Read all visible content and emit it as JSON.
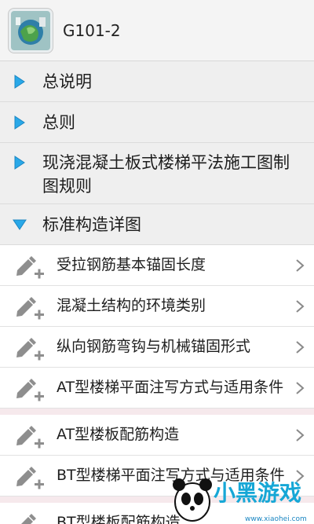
{
  "app": {
    "title": "G101-2",
    "icon": "book-cover-icon"
  },
  "sections": [
    {
      "label": "总说明",
      "state": "collapsed"
    },
    {
      "label": "总则",
      "state": "collapsed"
    },
    {
      "label": "现浇混凝土板式楼梯平法施工图制图规则",
      "state": "collapsed"
    },
    {
      "label": "标准构造详图",
      "state": "expanded"
    }
  ],
  "items": [
    {
      "label": "受拉钢筋基本锚固长度"
    },
    {
      "label": "混凝土结构的环境类别"
    },
    {
      "label": "纵向钢筋弯钩与机械锚固形式"
    },
    {
      "label": "AT型楼梯平面注写方式与适用条件"
    },
    {
      "label": "AT型楼板配筋构造"
    },
    {
      "label": "BT型楼梯平面注写方式与适用条件"
    },
    {
      "label": "BT型楼板配筋构造"
    }
  ],
  "watermark": {
    "brand": "小黑游戏",
    "url": "www.xiaohei.com"
  },
  "colors": {
    "accent_arrow": "#29a8e8",
    "band": "#f6e9ec"
  }
}
